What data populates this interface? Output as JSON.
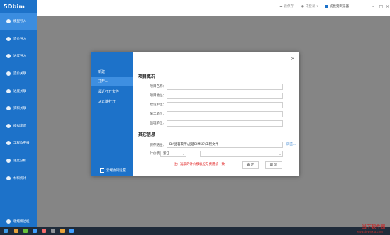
{
  "app": {
    "logo": "5Dbim"
  },
  "sidebar": {
    "items": [
      {
        "label": "模型导入",
        "icon": "layers-icon"
      },
      {
        "label": "造价导入",
        "icon": "price-icon"
      },
      {
        "label": "进度导入",
        "icon": "progress-icon"
      },
      {
        "label": "造价关联",
        "icon": "link-icon"
      },
      {
        "label": "进度关联",
        "icon": "link-icon"
      },
      {
        "label": "资料关联",
        "icon": "document-icon"
      },
      {
        "label": "模拟建造",
        "icon": "build-icon"
      },
      {
        "label": "工程款申报",
        "icon": "payment-icon"
      },
      {
        "label": "进度分析",
        "icon": "analysis-icon"
      },
      {
        "label": "材料统计",
        "icon": "stats-icon"
      }
    ],
    "footer": "收缩侧边栏"
  },
  "topbar": {
    "save": "云保存",
    "user": "未登录",
    "switch": "切换到浏览器"
  },
  "dialog": {
    "menu": [
      "新建",
      "打开...",
      "最近打开文件",
      "从云端打开"
    ],
    "cloud_settings": "云端协同设置",
    "section1": "项目概况",
    "fields": [
      {
        "label": "项目名称：",
        "value": ""
      },
      {
        "label": "项目地址：",
        "value": ""
      },
      {
        "label": "建设单位：",
        "value": ""
      },
      {
        "label": "施工单位：",
        "value": ""
      },
      {
        "label": "监理单位：",
        "value": ""
      }
    ],
    "section2": "其它信息",
    "save_path_label": "保存路径：",
    "save_path_value": "D:\\品茗软件\\品茗BIM5D\\工程文件",
    "browse": "浏览...",
    "pricing_label": "计价模板：",
    "pricing_value": "浙江",
    "note": "注：选取的计价模板应与费用统一致",
    "ok": "确 定",
    "cancel": "取 消"
  },
  "watermark": {
    "title": "当下软件园",
    "url": "www.downxia.com"
  },
  "colors": {
    "brand": "#1d72c9",
    "active": "#3b8de0"
  }
}
